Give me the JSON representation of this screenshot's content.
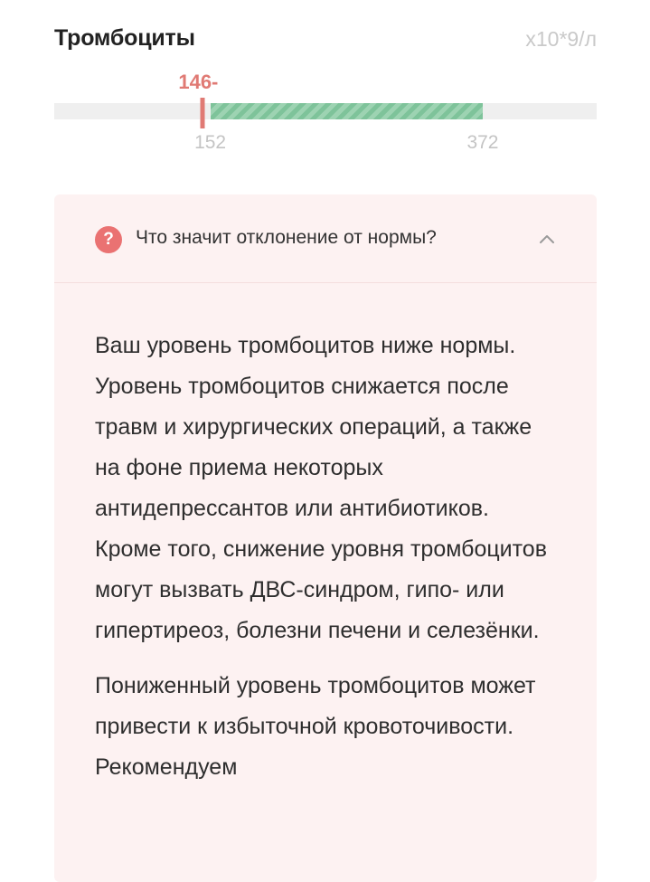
{
  "header": {
    "title": "Тромбоциты",
    "unit": "х10*9/л"
  },
  "range": {
    "value_label": "146-",
    "value": 146,
    "norm_min": 152,
    "norm_max": 372,
    "min_label": "152",
    "max_label": "372",
    "scale_min": 26,
    "scale_max": 464,
    "colors": {
      "value": "#e07a74",
      "norm": "#7ec39a",
      "track": "#efefef"
    }
  },
  "explanation": {
    "icon": "question-circle-icon",
    "question": "Что значит отклонение от нормы?",
    "toggle_icon": "chevron-up-icon",
    "paragraphs": [
      "Ваш уровень тромбоцитов ниже нормы. Уровень тромбоцитов снижается после травм и хирургических операций, а также на фоне приема некоторых антидепрессантов или антибиотиков. Кроме того, снижение уровня тромбоцитов могут вызвать ДВС-синдром, гипо- или гипертиреоз, болезни печени и селезёнки.",
      "Пониженный уровень тромбоцитов может привести к избыточной кровоточивости. Рекомендуем"
    ],
    "colors": {
      "background": "#fdf2f2",
      "icon": "#ea7272"
    }
  }
}
